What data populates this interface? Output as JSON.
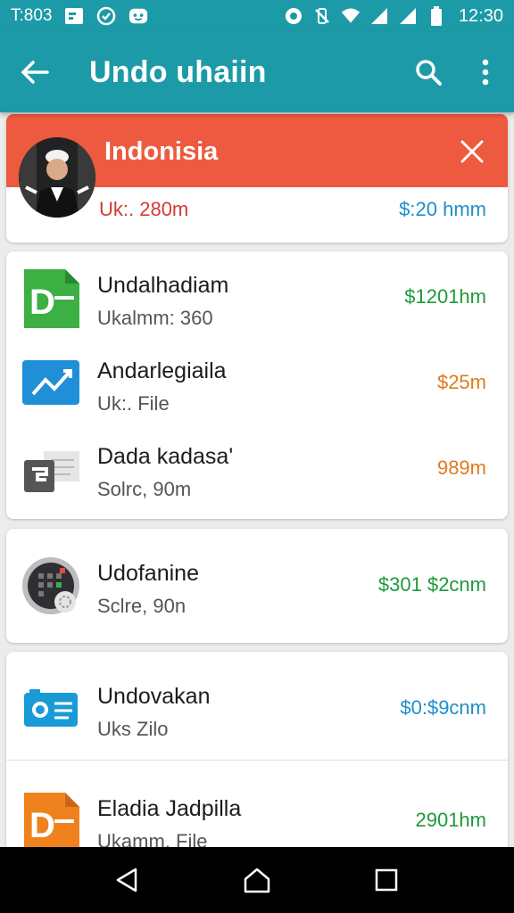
{
  "status_bar": {
    "left_time": "T:803",
    "icons_left": [
      "pp-icon",
      "clock-icon",
      "chat-icon"
    ],
    "icons_right": [
      "record-icon",
      "vibrate-icon",
      "wifi-icon",
      "signal-icon",
      "battery-icon"
    ],
    "clock": "12:30"
  },
  "app_bar": {
    "title": "Undo uhaiin",
    "back_icon": "arrow-left-icon",
    "search_icon": "search-icon",
    "more_icon": "more-vert-icon"
  },
  "colors": {
    "accent": "#1d9aa7",
    "banner": "#ee5a3f",
    "green": "#1e9a3a",
    "orange": "#e07a1c",
    "blue": "#1d8fc9"
  },
  "banner_card": {
    "title": "Indonisia",
    "subtitle": "Uk:. 280m",
    "price": "$:20 hmm"
  },
  "list_card": {
    "items": [
      {
        "name": "Undalhadiam",
        "meta": "Ukalmm: 360",
        "amount": "$1201hm",
        "icon": "document-green-icon"
      },
      {
        "name": "Andarlegiaila",
        "meta": "Uk:. File",
        "amount": "$25m",
        "icon": "chart-blue-icon"
      },
      {
        "name": "Dada kadasa'",
        "meta": "Solrc, 90m",
        "amount": "989m",
        "icon": "file-gray-icon"
      }
    ]
  },
  "single_card": {
    "name": "Udofanine",
    "meta": "Sclre, 90n",
    "amount": "$301 $2cnm",
    "icon": "calculator-icon"
  },
  "bottom_card": {
    "items": [
      {
        "name": "Undovakan",
        "meta": "Uks Zilo",
        "amount": "$0:$9cnm",
        "icon": "camera-card-icon"
      },
      {
        "name": "Eladia Jadpilla",
        "meta": "Ukamm. File",
        "amount": "2901hm",
        "icon": "document-orange-icon"
      }
    ]
  },
  "nav_bar": {
    "back": "nav-back-icon",
    "home": "nav-home-icon",
    "recents": "nav-recents-icon"
  }
}
